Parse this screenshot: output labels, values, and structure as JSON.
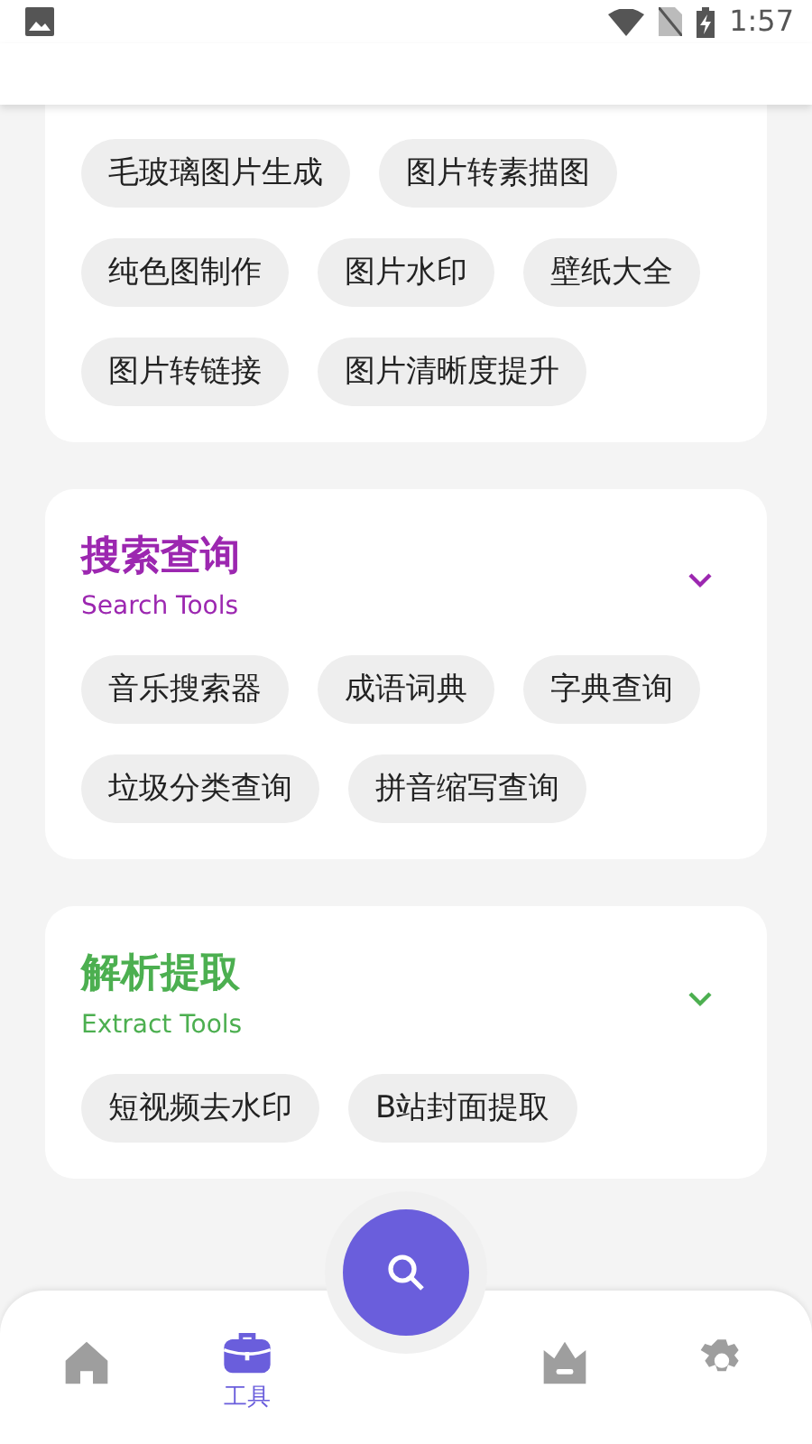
{
  "status_bar": {
    "time": "1:57"
  },
  "sections": [
    {
      "tools": [
        "毛玻璃图片生成",
        "图片转素描图",
        "纯色图制作",
        "图片水印",
        "壁纸大全",
        "图片转链接",
        "图片清晰度提升"
      ]
    },
    {
      "title": "搜索查询",
      "subtitle": "Search Tools",
      "color": "#9c27b0",
      "tools": [
        "音乐搜索器",
        "成语词典",
        "字典查询",
        "垃圾分类查询",
        "拼音缩写查询"
      ]
    },
    {
      "title": "解析提取",
      "subtitle": "Extract Tools",
      "color": "#4caf50",
      "tools": [
        "短视频去水印",
        "B站封面提取"
      ]
    }
  ],
  "bottom_nav": [
    {
      "selected": false
    },
    {
      "label": "工具",
      "selected": true
    },
    {
      "selected": false
    },
    {
      "selected": false
    }
  ]
}
